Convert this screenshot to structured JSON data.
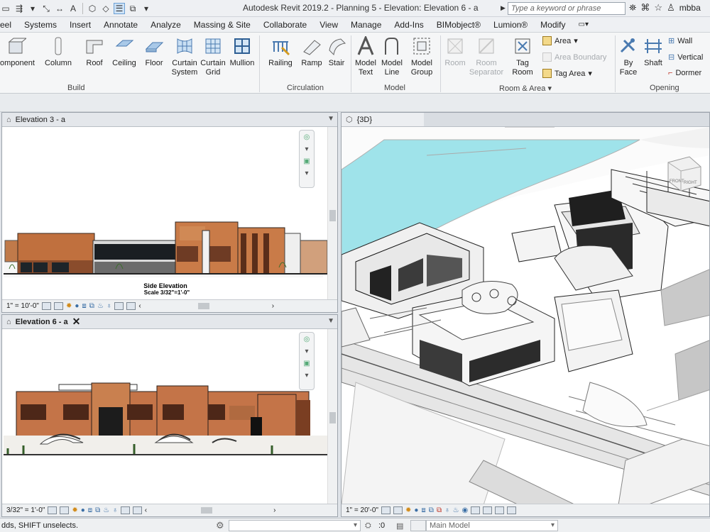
{
  "window": {
    "title": "Autodesk Revit 2019.2 - Planning 5 - Elevation: Elevation 6 - a"
  },
  "search": {
    "placeholder": "Type a keyword or phrase"
  },
  "user": {
    "name": "mbba"
  },
  "menu": [
    "eel",
    "Systems",
    "Insert",
    "Annotate",
    "Analyze",
    "Massing & Site",
    "Collaborate",
    "View",
    "Manage",
    "Add-Ins",
    "BIMobject®",
    "Lumion®",
    "Modify"
  ],
  "ribbon": {
    "build": {
      "label": "Build",
      "component": "omponent",
      "column": "Column",
      "roof": "Roof",
      "ceiling": "Ceiling",
      "floor": "Floor",
      "curtain_system_1": "Curtain",
      "curtain_system_2": "System",
      "curtain_grid_1": "Curtain",
      "curtain_grid_2": "Grid",
      "mullion": "Mullion"
    },
    "circulation": {
      "label": "Circulation",
      "railing": "Railing",
      "ramp": "Ramp",
      "stair": "Stair"
    },
    "model": {
      "label": "Model",
      "text_1": "Model",
      "text_2": "Text",
      "line_1": "Model",
      "line_2": "Line",
      "group_1": "Model",
      "group_2": "Group"
    },
    "room_area": {
      "label": "Room & Area",
      "room": "Room",
      "sep_1": "Room",
      "sep_2": "Separator",
      "tag_1": "Tag",
      "tag_2": "Room",
      "area": "Area",
      "area_boundary": "Area  Boundary",
      "tag_area": "Tag  Area"
    },
    "opening": {
      "label": "Opening",
      "byface_1": "By",
      "byface_2": "Face",
      "shaft": "Shaft",
      "wall": "Wall",
      "vertical": "Vertical",
      "dormer": "Dormer"
    }
  },
  "views": {
    "elev3": {
      "tab": "Elevation 3 - a",
      "caption_1": "Side Elevation",
      "caption_2": "Scale 3/32\"=1'-0\"",
      "scale": "1\" = 10'-0\""
    },
    "elev6": {
      "tab": "Elevation 6 - a",
      "scale": "3/32\" = 1'-0\""
    },
    "view3d": {
      "tab": "{3D}",
      "scale": "1\" = 20'-0\"",
      "cube_front": "FRONT",
      "cube_right": "RIGHT"
    }
  },
  "status": {
    "message": "dds, SHIFT unselects.",
    "count": ":0",
    "model": "Main Model"
  }
}
